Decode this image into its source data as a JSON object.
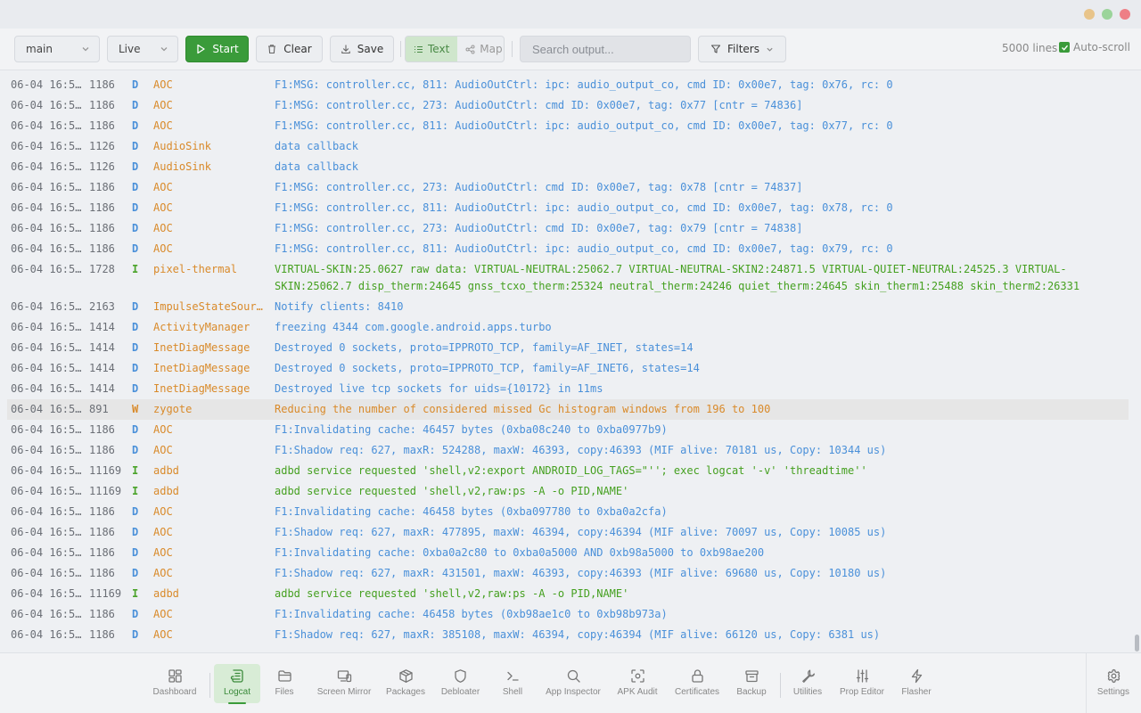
{
  "toolbar": {
    "device_select": "main",
    "mode_select": "Live",
    "start_label": "Start",
    "clear_label": "Clear",
    "save_label": "Save",
    "view_text_label": "Text",
    "view_map_label": "Map",
    "search_placeholder": "Search output...",
    "filters_label": "Filters",
    "line_count": "5000 lines",
    "autoscroll_label": "Auto-scroll"
  },
  "log": {
    "rows": [
      {
        "ts": "06-04 16:5…",
        "pid": "1186",
        "level": "D",
        "tag": "AOC",
        "msg": "F1:MSG: controller.cc, 811: AudioOutCtrl: ipc: audio_output_co, cmd ID: 0x00e7, tag: 0x76, rc: 0"
      },
      {
        "ts": "06-04 16:5…",
        "pid": "1186",
        "level": "D",
        "tag": "AOC",
        "msg": "F1:MSG: controller.cc, 273: AudioOutCtrl: cmd ID: 0x00e7, tag: 0x77 [cntr = 74836]"
      },
      {
        "ts": "06-04 16:5…",
        "pid": "1186",
        "level": "D",
        "tag": "AOC",
        "msg": "F1:MSG: controller.cc, 811: AudioOutCtrl: ipc: audio_output_co, cmd ID: 0x00e7, tag: 0x77, rc: 0"
      },
      {
        "ts": "06-04 16:5…",
        "pid": "1126",
        "level": "D",
        "tag": "AudioSink",
        "msg": "data callback"
      },
      {
        "ts": "06-04 16:5…",
        "pid": "1126",
        "level": "D",
        "tag": "AudioSink",
        "msg": "data callback"
      },
      {
        "ts": "06-04 16:5…",
        "pid": "1186",
        "level": "D",
        "tag": "AOC",
        "msg": "F1:MSG: controller.cc, 273: AudioOutCtrl: cmd ID: 0x00e7, tag: 0x78 [cntr = 74837]"
      },
      {
        "ts": "06-04 16:5…",
        "pid": "1186",
        "level": "D",
        "tag": "AOC",
        "msg": "F1:MSG: controller.cc, 811: AudioOutCtrl: ipc: audio_output_co, cmd ID: 0x00e7, tag: 0x78, rc: 0"
      },
      {
        "ts": "06-04 16:5…",
        "pid": "1186",
        "level": "D",
        "tag": "AOC",
        "msg": "F1:MSG: controller.cc, 273: AudioOutCtrl: cmd ID: 0x00e7, tag: 0x79 [cntr = 74838]"
      },
      {
        "ts": "06-04 16:5…",
        "pid": "1186",
        "level": "D",
        "tag": "AOC",
        "msg": "F1:MSG: controller.cc, 811: AudioOutCtrl: ipc: audio_output_co, cmd ID: 0x00e7, tag: 0x79, rc: 0"
      },
      {
        "ts": "06-04 16:5…",
        "pid": "1728",
        "level": "I",
        "tag": "pixel-thermal",
        "msg": "VIRTUAL-SKIN:25.0627 raw data: VIRTUAL-NEUTRAL:25062.7 VIRTUAL-NEUTRAL-SKIN2:24871.5 VIRTUAL-QUIET-NEUTRAL:24525.3 VIRTUAL-SKIN:25062.7 disp_therm:24645 gnss_tcxo_therm:25324 neutral_therm:24246 quiet_therm:24645 skin_therm1:25488 skin_therm2:26331"
      },
      {
        "ts": "06-04 16:5…",
        "pid": "2163",
        "level": "D",
        "tag": "ImpulseStateSour…",
        "msg": "Notify clients: 8410"
      },
      {
        "ts": "06-04 16:5…",
        "pid": "1414",
        "level": "D",
        "tag": "ActivityManager",
        "msg": "freezing 4344 com.google.android.apps.turbo"
      },
      {
        "ts": "06-04 16:5…",
        "pid": "1414",
        "level": "D",
        "tag": "InetDiagMessage",
        "msg": "Destroyed 0 sockets, proto=IPPROTO_TCP, family=AF_INET, states=14"
      },
      {
        "ts": "06-04 16:5…",
        "pid": "1414",
        "level": "D",
        "tag": "InetDiagMessage",
        "msg": "Destroyed 0 sockets, proto=IPPROTO_TCP, family=AF_INET6, states=14"
      },
      {
        "ts": "06-04 16:5…",
        "pid": "1414",
        "level": "D",
        "tag": "InetDiagMessage",
        "msg": "Destroyed live tcp sockets for uids={10172} in 11ms"
      },
      {
        "ts": "06-04 16:5…",
        "pid": "891",
        "level": "W",
        "tag": "zygote",
        "msg": "Reducing the number of considered missed Gc histogram windows from 196 to 100"
      },
      {
        "ts": "06-04 16:5…",
        "pid": "1186",
        "level": "D",
        "tag": "AOC",
        "msg": "F1:Invalidating cache: 46457 bytes (0xba08c240 to 0xba0977b9)"
      },
      {
        "ts": "06-04 16:5…",
        "pid": "1186",
        "level": "D",
        "tag": "AOC",
        "msg": "F1:Shadow req: 627, maxR: 524288, maxW: 46393, copy:46393 (MIF alive: 70181 us, Copy: 10344 us)"
      },
      {
        "ts": "06-04 16:5…",
        "pid": "11169",
        "level": "I",
        "tag": "adbd",
        "msg": "adbd service requested 'shell,v2:export ANDROID_LOG_TAGS=\"''; exec logcat '-v' 'threadtime''"
      },
      {
        "ts": "06-04 16:5…",
        "pid": "11169",
        "level": "I",
        "tag": "adbd",
        "msg": "adbd service requested 'shell,v2,raw:ps -A -o PID,NAME'"
      },
      {
        "ts": "06-04 16:5…",
        "pid": "1186",
        "level": "D",
        "tag": "AOC",
        "msg": "F1:Invalidating cache: 46458 bytes (0xba097780 to 0xba0a2cfa)"
      },
      {
        "ts": "06-04 16:5…",
        "pid": "1186",
        "level": "D",
        "tag": "AOC",
        "msg": "F1:Shadow req: 627, maxR: 477895, maxW: 46394, copy:46394 (MIF alive: 70097 us, Copy: 10085 us)"
      },
      {
        "ts": "06-04 16:5…",
        "pid": "1186",
        "level": "D",
        "tag": "AOC",
        "msg": "F1:Invalidating cache: 0xba0a2c80 to 0xba0a5000 AND 0xb98a5000 to 0xb98ae200"
      },
      {
        "ts": "06-04 16:5…",
        "pid": "1186",
        "level": "D",
        "tag": "AOC",
        "msg": "F1:Shadow req: 627, maxR: 431501, maxW: 46393, copy:46393 (MIF alive: 69680 us, Copy: 10180 us)"
      },
      {
        "ts": "06-04 16:5…",
        "pid": "11169",
        "level": "I",
        "tag": "adbd",
        "msg": "adbd service requested 'shell,v2,raw:ps -A -o PID,NAME'"
      },
      {
        "ts": "06-04 16:5…",
        "pid": "1186",
        "level": "D",
        "tag": "AOC",
        "msg": "F1:Invalidating cache: 46458 bytes (0xb98ae1c0 to 0xb98b973a)"
      },
      {
        "ts": "06-04 16:5…",
        "pid": "1186",
        "level": "D",
        "tag": "AOC",
        "msg": "F1:Shadow req: 627, maxR: 385108, maxW: 46394, copy:46394 (MIF alive: 66120 us, Copy: 6381 us)"
      }
    ]
  },
  "nav": {
    "items": [
      {
        "id": "dashboard",
        "label": "Dashboard",
        "icon": "dashboard-icon"
      },
      {
        "id": "logcat",
        "label": "Logcat",
        "icon": "logcat-icon",
        "active": true
      },
      {
        "id": "files",
        "label": "Files",
        "icon": "folder-icon"
      },
      {
        "id": "screen-mirror",
        "label": "Screen Mirror",
        "icon": "screen-mirror-icon"
      },
      {
        "id": "packages",
        "label": "Packages",
        "icon": "package-icon"
      },
      {
        "id": "debloater",
        "label": "Debloater",
        "icon": "shield-icon"
      },
      {
        "id": "shell",
        "label": "Shell",
        "icon": "terminal-icon"
      },
      {
        "id": "app-inspector",
        "label": "App Inspector",
        "icon": "search-icon"
      },
      {
        "id": "apk-audit",
        "label": "APK Audit",
        "icon": "scan-icon"
      },
      {
        "id": "certificates",
        "label": "Certificates",
        "icon": "lock-icon"
      },
      {
        "id": "backup",
        "label": "Backup",
        "icon": "archive-icon"
      },
      {
        "id": "utilities",
        "label": "Utilities",
        "icon": "wrench-icon"
      },
      {
        "id": "prop-editor",
        "label": "Prop Editor",
        "icon": "sliders-icon"
      },
      {
        "id": "flasher",
        "label": "Flasher",
        "icon": "lightning-icon"
      },
      {
        "id": "settings",
        "label": "Settings",
        "icon": "gear-icon"
      }
    ]
  },
  "colors": {
    "accent": "#3a9b3a",
    "debug": "#4a90d9",
    "info": "#45a020",
    "warn": "#d98a2a"
  }
}
